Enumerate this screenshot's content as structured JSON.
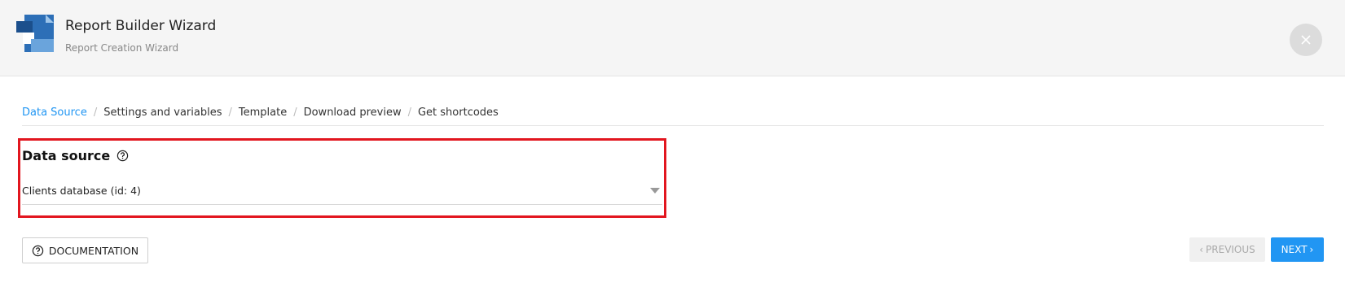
{
  "header": {
    "title": "Report Builder Wizard",
    "subtitle": "Report Creation Wizard",
    "logo_icon": "report-builder-logo-icon",
    "close_icon": "close-icon"
  },
  "breadcrumb": {
    "items": [
      {
        "label": "Data Source",
        "active": true
      },
      {
        "label": "Settings and variables",
        "active": false
      },
      {
        "label": "Template",
        "active": false
      },
      {
        "label": "Download preview",
        "active": false
      },
      {
        "label": "Get shortcodes",
        "active": false
      }
    ],
    "separator": "/"
  },
  "data_source": {
    "title": "Data source",
    "help_icon": "question-circle-icon",
    "selected": "Clients database (id: 4)"
  },
  "footer": {
    "documentation_label": "DOCUMENTATION",
    "previous_label": "PREVIOUS",
    "next_label": "NEXT",
    "previous_enabled": false,
    "next_enabled": true
  },
  "colors": {
    "accent": "#2196f3",
    "highlight": "#e2161f",
    "header_bg": "#f5f5f5"
  }
}
